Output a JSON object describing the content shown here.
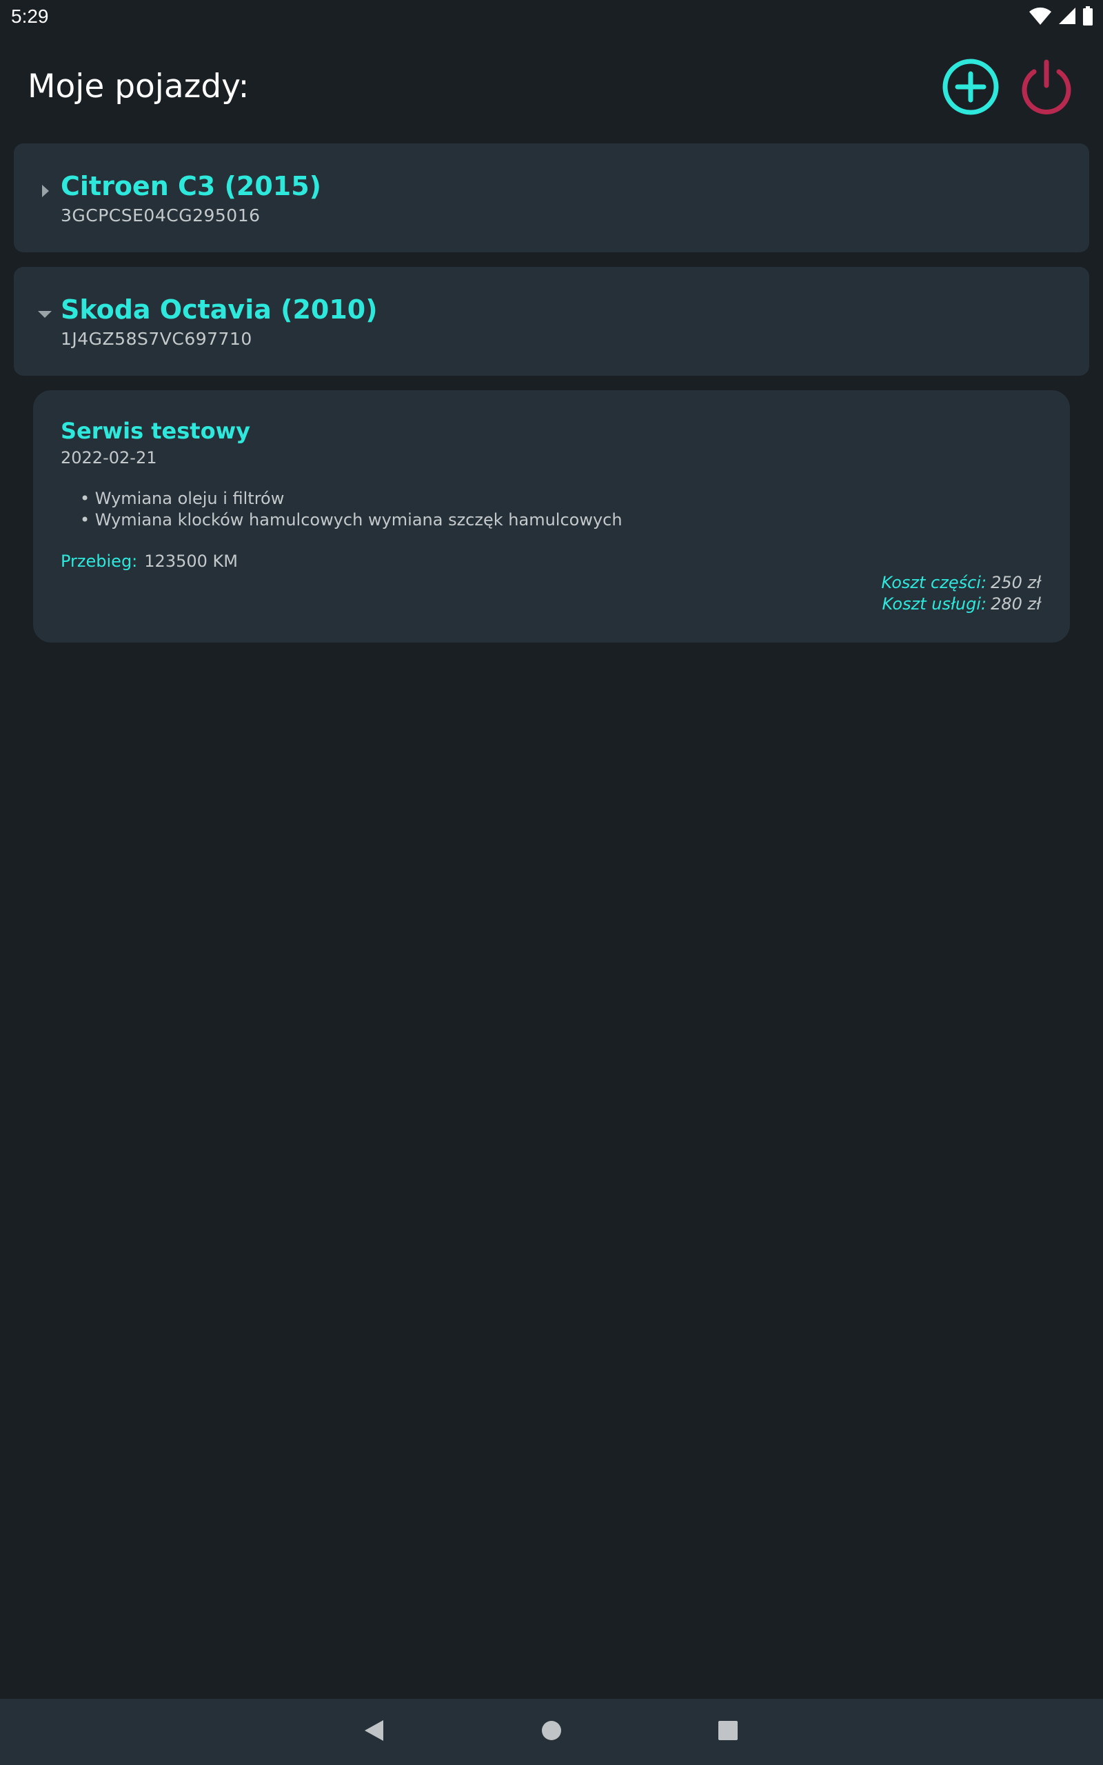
{
  "status_bar": {
    "time": "5:29",
    "icons": [
      "wifi-icon",
      "signal-icon",
      "battery-icon"
    ]
  },
  "header": {
    "title": "Moje pojazdy:",
    "add_icon": "add-circle-icon",
    "power_icon": "power-icon"
  },
  "colors": {
    "background": "#1a1f23",
    "card": "#263038",
    "accent": "#2ee8dc",
    "power": "#b8294f",
    "text_secondary": "#c4c9cc"
  },
  "vehicles": [
    {
      "name": "Citroen C3 (2015)",
      "vin": "3GCPCSE04CG295016",
      "expanded": false
    },
    {
      "name": "Skoda Octavia (2010)",
      "vin": "1J4GZ58S7VC697710",
      "expanded": true
    }
  ],
  "service": {
    "title": "Serwis testowy",
    "date": "2022-02-21",
    "items": [
      "• Wymiana oleju i filtrów",
      "• Wymiana klocków hamulcowych wymiana szczęk hamulcowych"
    ],
    "mileage_label": "Przebieg:",
    "mileage_value": "123500 KM",
    "parts_cost_label": "Koszt części:",
    "parts_cost_value": "250 zł",
    "service_cost_label": "Koszt usługi:",
    "service_cost_value": "280 zł"
  },
  "nav": {
    "back_icon": "back-icon",
    "home_icon": "home-icon",
    "recents_icon": "recents-icon"
  }
}
